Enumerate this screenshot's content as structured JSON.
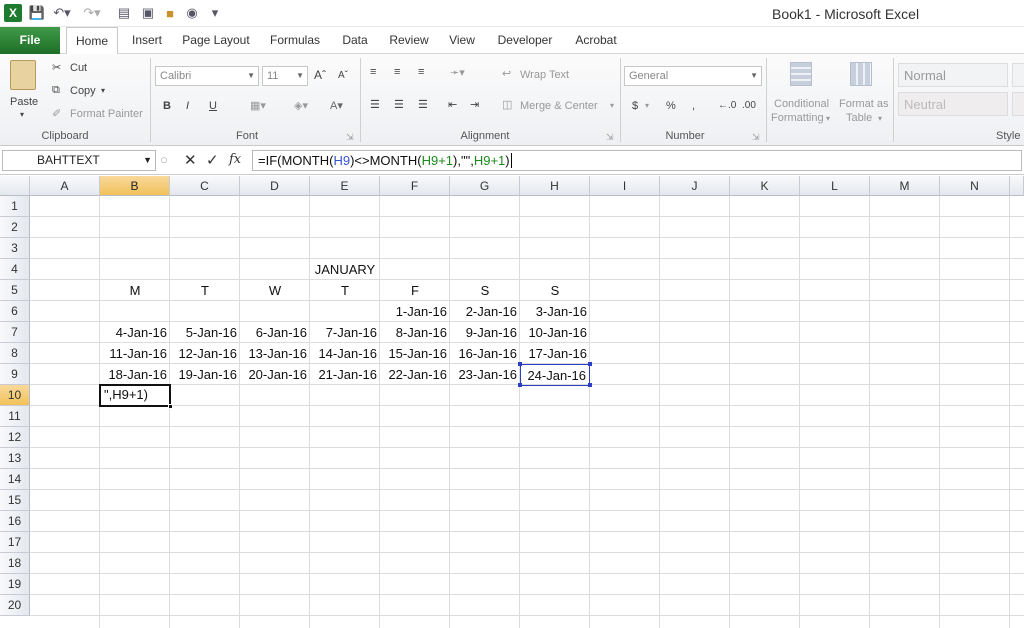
{
  "app": {
    "title": "Book1  -  Microsoft Excel"
  },
  "tabs": [
    "File",
    "Home",
    "Insert",
    "Page Layout",
    "Formulas",
    "Data",
    "Review",
    "View",
    "Developer",
    "Acrobat"
  ],
  "clipboard": {
    "paste": "Paste",
    "cut": "Cut",
    "copy": "Copy",
    "format_painter": "Format Painter",
    "label": "Clipboard"
  },
  "font": {
    "name": "Calibri",
    "size": "11",
    "label": "Font"
  },
  "alignment": {
    "wrap_text": "Wrap Text",
    "merge_center": "Merge & Center",
    "label": "Alignment"
  },
  "number": {
    "format": "General",
    "label": "Number"
  },
  "styles": {
    "conditional": "Conditional",
    "formatting": "Formatting",
    "format_as": "Format as",
    "table": "Table",
    "normal": "Normal",
    "neutral": "Neutral",
    "label": "Style"
  },
  "formula_bar": {
    "name_box": "BAHTTEXT",
    "fx": "fx",
    "formula_prefix": "=IF(MONTH(",
    "ref1": "H9",
    "mid1": ")<>MONTH(",
    "ref2": "H9+1",
    "mid2": "),\"\",",
    "ref3": "H9+1",
    "suffix": ")"
  },
  "columns": [
    "A",
    "B",
    "C",
    "D",
    "E",
    "F",
    "G",
    "H",
    "I",
    "J",
    "K",
    "L",
    "M",
    "N"
  ],
  "rows": [
    "1",
    "2",
    "3",
    "4",
    "5",
    "6",
    "7",
    "8",
    "9",
    "10",
    "11",
    "12",
    "13",
    "14",
    "15",
    "16",
    "17",
    "18",
    "19",
    "20"
  ],
  "sheet": {
    "month": "JANUARY",
    "days": [
      "M",
      "T",
      "W",
      "T",
      "F",
      "S",
      "S"
    ],
    "week1": [
      "",
      "",
      "",
      "",
      "1-Jan-16",
      "2-Jan-16",
      "3-Jan-16"
    ],
    "week2": [
      "4-Jan-16",
      "5-Jan-16",
      "6-Jan-16",
      "7-Jan-16",
      "8-Jan-16",
      "9-Jan-16",
      "10-Jan-16"
    ],
    "week3": [
      "11-Jan-16",
      "12-Jan-16",
      "13-Jan-16",
      "14-Jan-16",
      "15-Jan-16",
      "16-Jan-16",
      "17-Jan-16"
    ],
    "week4": [
      "18-Jan-16",
      "19-Jan-16",
      "20-Jan-16",
      "21-Jan-16",
      "22-Jan-16",
      "23-Jan-16",
      "24-Jan-16"
    ],
    "editing_cell": "\",H9+1)"
  }
}
